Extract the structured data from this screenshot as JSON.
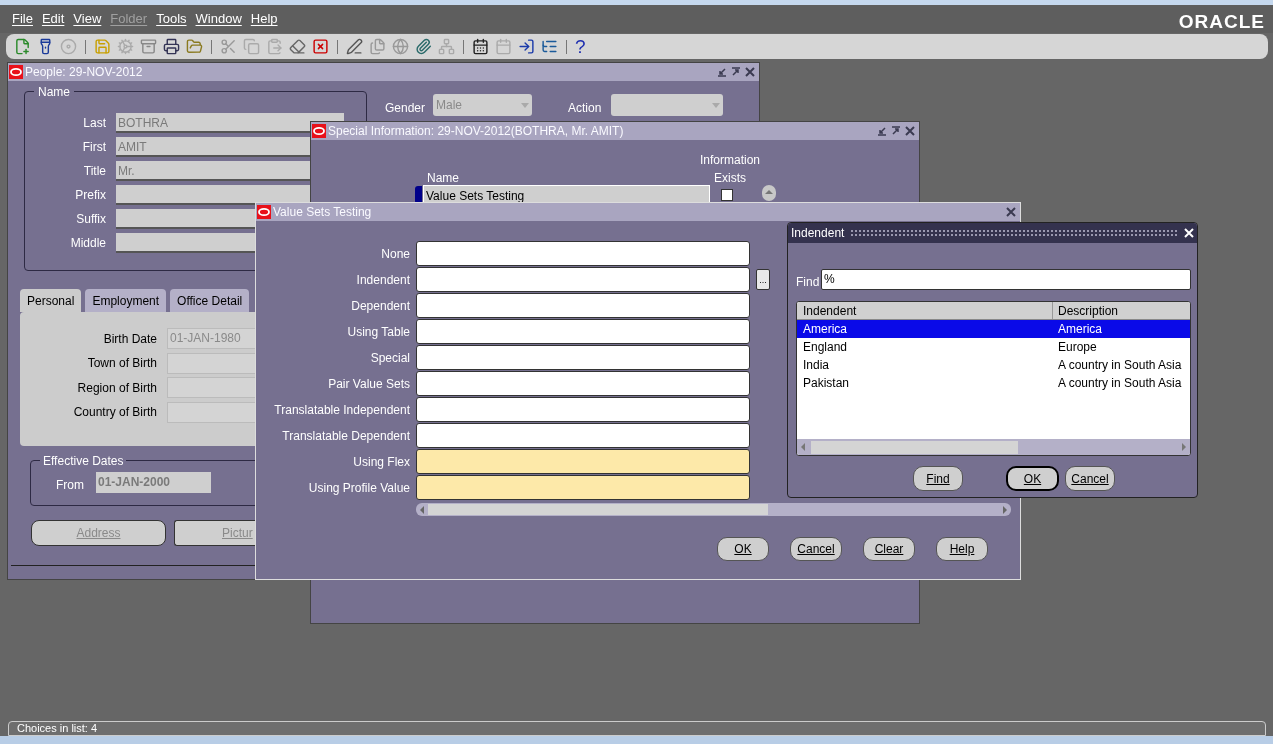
{
  "menu": [
    {
      "label": "File",
      "disabled": false
    },
    {
      "label": "Edit",
      "disabled": false
    },
    {
      "label": "View",
      "disabled": false
    },
    {
      "label": "Folder",
      "disabled": true
    },
    {
      "label": "Tools",
      "disabled": false
    },
    {
      "label": "Window",
      "disabled": false
    },
    {
      "label": "Help",
      "disabled": false
    }
  ],
  "brand": "ORACLE",
  "help_glyph": "?",
  "people_window": {
    "title": "People: 29-NOV-2012",
    "name_group": {
      "legend": "Name",
      "fields": [
        {
          "label": "Last",
          "value": "BOTHRA"
        },
        {
          "label": "First",
          "value": "AMIT"
        },
        {
          "label": "Title",
          "value": "Mr."
        },
        {
          "label": "Prefix"
        },
        {
          "label": "Suffix"
        },
        {
          "label": "Middle"
        }
      ]
    },
    "gender": {
      "label": "Gender",
      "value": "Male"
    },
    "action": {
      "label": "Action"
    },
    "tabs": [
      {
        "label": "Personal",
        "selected": true
      },
      {
        "label": "Employment",
        "selected": false
      },
      {
        "label": "Office Detail",
        "selected": false
      }
    ],
    "personal_fields": [
      {
        "label": "Birth Date",
        "value": "01-JAN-1980"
      },
      {
        "label": "Town of Birth"
      },
      {
        "label": "Region of Birth"
      },
      {
        "label": "Country of Birth"
      }
    ],
    "effective_dates": {
      "legend": "Effective Dates",
      "from_label": "From",
      "from_value": "01-JAN-2000"
    },
    "buttons": [
      "Address",
      "Pictur"
    ]
  },
  "special_information_window": {
    "title": "Special Information: 29-NOV-2012(BOTHRA, Mr. AMIT)",
    "columns": [
      "Name",
      "Information Exists"
    ],
    "rows": [
      {
        "name": "Value Sets Testing",
        "information_exists": false
      }
    ]
  },
  "value_sets_window": {
    "title": "Value Sets Testing",
    "fields": [
      {
        "label": "None",
        "required": false,
        "lov": false
      },
      {
        "label": "Indendent",
        "required": false,
        "lov": true
      },
      {
        "label": "Dependent",
        "required": false,
        "lov": false
      },
      {
        "label": "Using Table",
        "required": false,
        "lov": false
      },
      {
        "label": "Special",
        "required": false,
        "lov": false
      },
      {
        "label": "Pair Value Sets",
        "required": false,
        "lov": false
      },
      {
        "label": "Translatable Independent",
        "required": false,
        "lov": false
      },
      {
        "label": "Translatable Dependent",
        "required": false,
        "lov": false
      },
      {
        "label": "Using Flex",
        "required": true,
        "lov": false
      },
      {
        "label": "Using Profile Value",
        "required": true,
        "lov": false
      }
    ],
    "lov_button": "...",
    "buttons": [
      "OK",
      "Cancel",
      "Clear",
      "Help"
    ]
  },
  "lov_window": {
    "title": "Indendent",
    "find_label": "Find",
    "find_value": "%",
    "columns": [
      "Indendent",
      "Description"
    ],
    "rows": [
      {
        "indendent": "America",
        "description": "America",
        "selected": true
      },
      {
        "indendent": "England",
        "description": "Europe",
        "selected": false
      },
      {
        "indendent": "India",
        "description": "A country in South Asia",
        "selected": false
      },
      {
        "indendent": "Pakistan",
        "description": "A country in South Asia",
        "selected": false
      }
    ],
    "buttons": [
      {
        "label": "Find",
        "default": false
      },
      {
        "label": "OK",
        "default": true
      },
      {
        "label": "Cancel",
        "default": false
      }
    ]
  },
  "status_bar": "Choices in list: 4"
}
